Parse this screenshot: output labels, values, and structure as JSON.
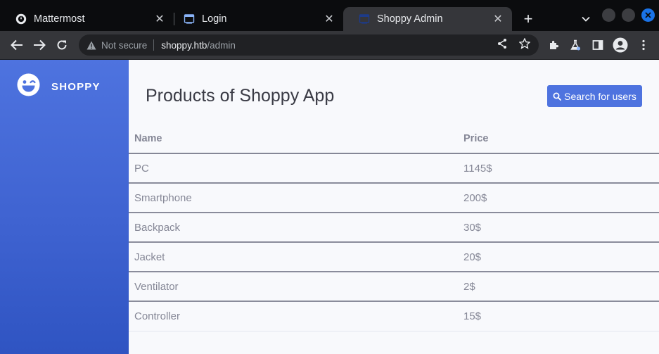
{
  "browser": {
    "tabs": [
      {
        "title": "Mattermost",
        "icon": "mattermost-icon",
        "active": false
      },
      {
        "title": "Login",
        "icon": "page-icon",
        "active": false
      },
      {
        "title": "Shoppy Admin",
        "icon": "page-icon",
        "active": true
      }
    ],
    "address": {
      "security_label": "Not secure",
      "host": "shoppy.htb",
      "path": "/admin"
    },
    "colors": {
      "tabbar": "#0b0c0e",
      "toolbar": "#35363a",
      "close_window": "#1a73e8"
    }
  },
  "sidebar": {
    "brand": "SHOPPY",
    "logo_icon": "laugh-wink-icon",
    "color": "#4e73df"
  },
  "main": {
    "title": "Products of Shoppy App",
    "search_button": "Search for users",
    "search_icon": "search-icon",
    "table": {
      "headers": [
        "Name",
        "Price"
      ],
      "rows": [
        [
          "PC",
          "1145$"
        ],
        [
          "Smartphone",
          "200$"
        ],
        [
          "Backpack",
          "30$"
        ],
        [
          "Jacket",
          "20$"
        ],
        [
          "Ventilator",
          "2$"
        ],
        [
          "Controller",
          "15$"
        ]
      ]
    }
  }
}
